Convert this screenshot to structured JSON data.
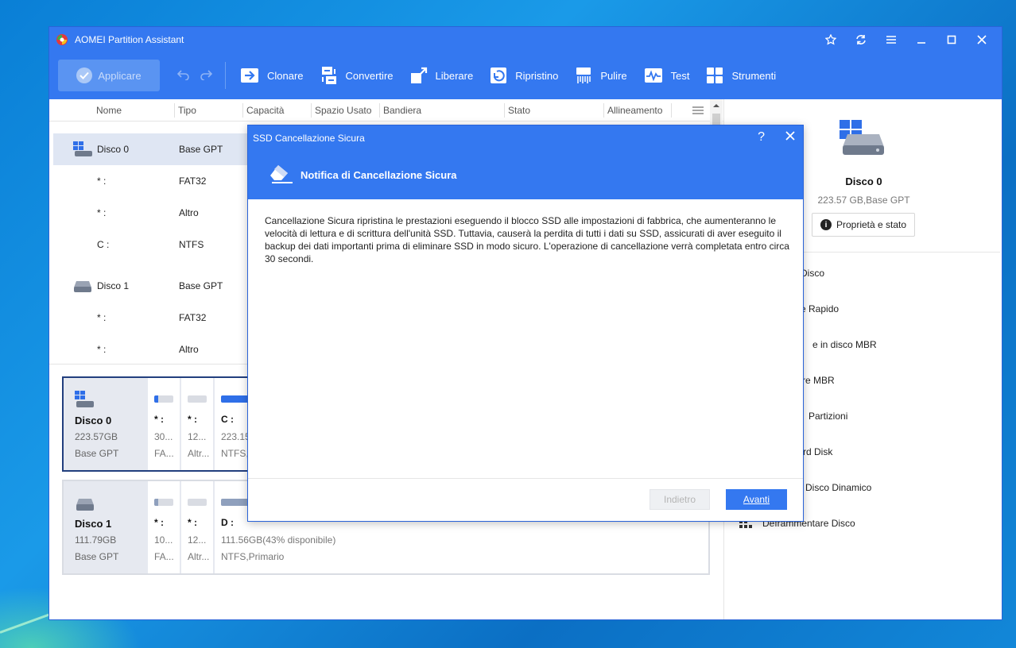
{
  "app": {
    "title": "AOMEI Partition Assistant"
  },
  "toolbar": {
    "apply_label": "Applicare",
    "items": [
      {
        "label": "Clonare"
      },
      {
        "label": "Convertire"
      },
      {
        "label": "Liberare"
      },
      {
        "label": "Ripristino"
      },
      {
        "label": "Pulire"
      },
      {
        "label": "Test"
      },
      {
        "label": "Strumenti"
      }
    ]
  },
  "columns": [
    "Nome",
    "Tipo",
    "Capacità",
    "Spazio Usato",
    "Bandiera",
    "Stato",
    "Allineamento"
  ],
  "rows": [
    {
      "name": "Disco 0",
      "type": "Base GPT"
    },
    {
      "name": "* :",
      "type": "FAT32"
    },
    {
      "name": "* :",
      "type": "Altro"
    },
    {
      "name": "C :",
      "type": "NTFS"
    },
    {
      "name": "Disco 1",
      "type": "Base GPT"
    },
    {
      "name": "* :",
      "type": "FAT32"
    },
    {
      "name": "* :",
      "type": "Altro"
    }
  ],
  "cards": [
    {
      "name": "Disco 0",
      "size": "223.57GB",
      "type": "Base GPT",
      "partitions": [
        {
          "label": "* :",
          "size": "30...",
          "fs": "FA...",
          "used": 0.2
        },
        {
          "label": "* :",
          "size": "12...",
          "fs": "Altr...",
          "used": 0.0
        },
        {
          "label": "C :",
          "size": "223.15",
          "fs": "NTFS,",
          "used": 0.57
        }
      ]
    },
    {
      "name": "Disco 1",
      "size": "111.79GB",
      "type": "Base GPT",
      "partitions": [
        {
          "label": "* :",
          "size": "10...",
          "fs": "FA...",
          "used": 0.2
        },
        {
          "label": "* :",
          "size": "12...",
          "fs": "Altr...",
          "used": 0.0
        },
        {
          "label": "D :",
          "size": "111.56GB(43% disponibile)",
          "fs": "NTFS,Primario",
          "used": 0.57
        }
      ]
    }
  ],
  "right_panel": {
    "disk_name": "Disco 0",
    "disk_info": "223.57 GB,Base GPT",
    "props_label": "Proprietà e stato",
    "items": [
      {
        "label": "Disco"
      },
      {
        "label": "e Rapido"
      },
      {
        "label": "e in disco MBR"
      },
      {
        "label": "re MBR"
      },
      {
        "label": "Partizioni"
      },
      {
        "label": "rd Disk"
      },
      {
        "label": "Disco Dinamico"
      },
      {
        "label": "Deframmentare Disco"
      }
    ]
  },
  "dialog": {
    "title": "SSD Cancellazione Sicura",
    "help": "?",
    "heading": "Notifica di Cancellazione Sicura",
    "body": "Cancellazione Sicura ripristina le prestazioni eseguendo il blocco SSD alle impostazioni di fabbrica, che aumenteranno le velocità di lettura e di scrittura dell'unità SSD. Tuttavia, causerà la perdita di tutti i dati su SSD, assicurati di aver eseguito il backup dei dati importanti prima di eliminare SSD in modo sicuro. L'operazione di cancellazione verrà completata entro circa 30 secondi.",
    "back_label": "Indietro",
    "next_label": "Avanti"
  },
  "colors": {
    "accent": "#3478f0",
    "bar_fill": "#2f6fe8",
    "bar_fill_inactive": "#8fa0bd",
    "selected_row": "#dfe6f3"
  },
  "icons": [
    "app-logo-icon",
    "star-icon",
    "refresh-icon",
    "menu-icon",
    "minimize-icon",
    "maximize-icon",
    "close-icon",
    "check-icon",
    "undo-icon",
    "redo-icon",
    "clone-icon",
    "convert-icon",
    "free-space-icon",
    "restore-icon",
    "wipe-icon",
    "test-icon",
    "tools-icon",
    "disk-icon",
    "info-icon",
    "eraser-icon",
    "help-icon"
  ]
}
